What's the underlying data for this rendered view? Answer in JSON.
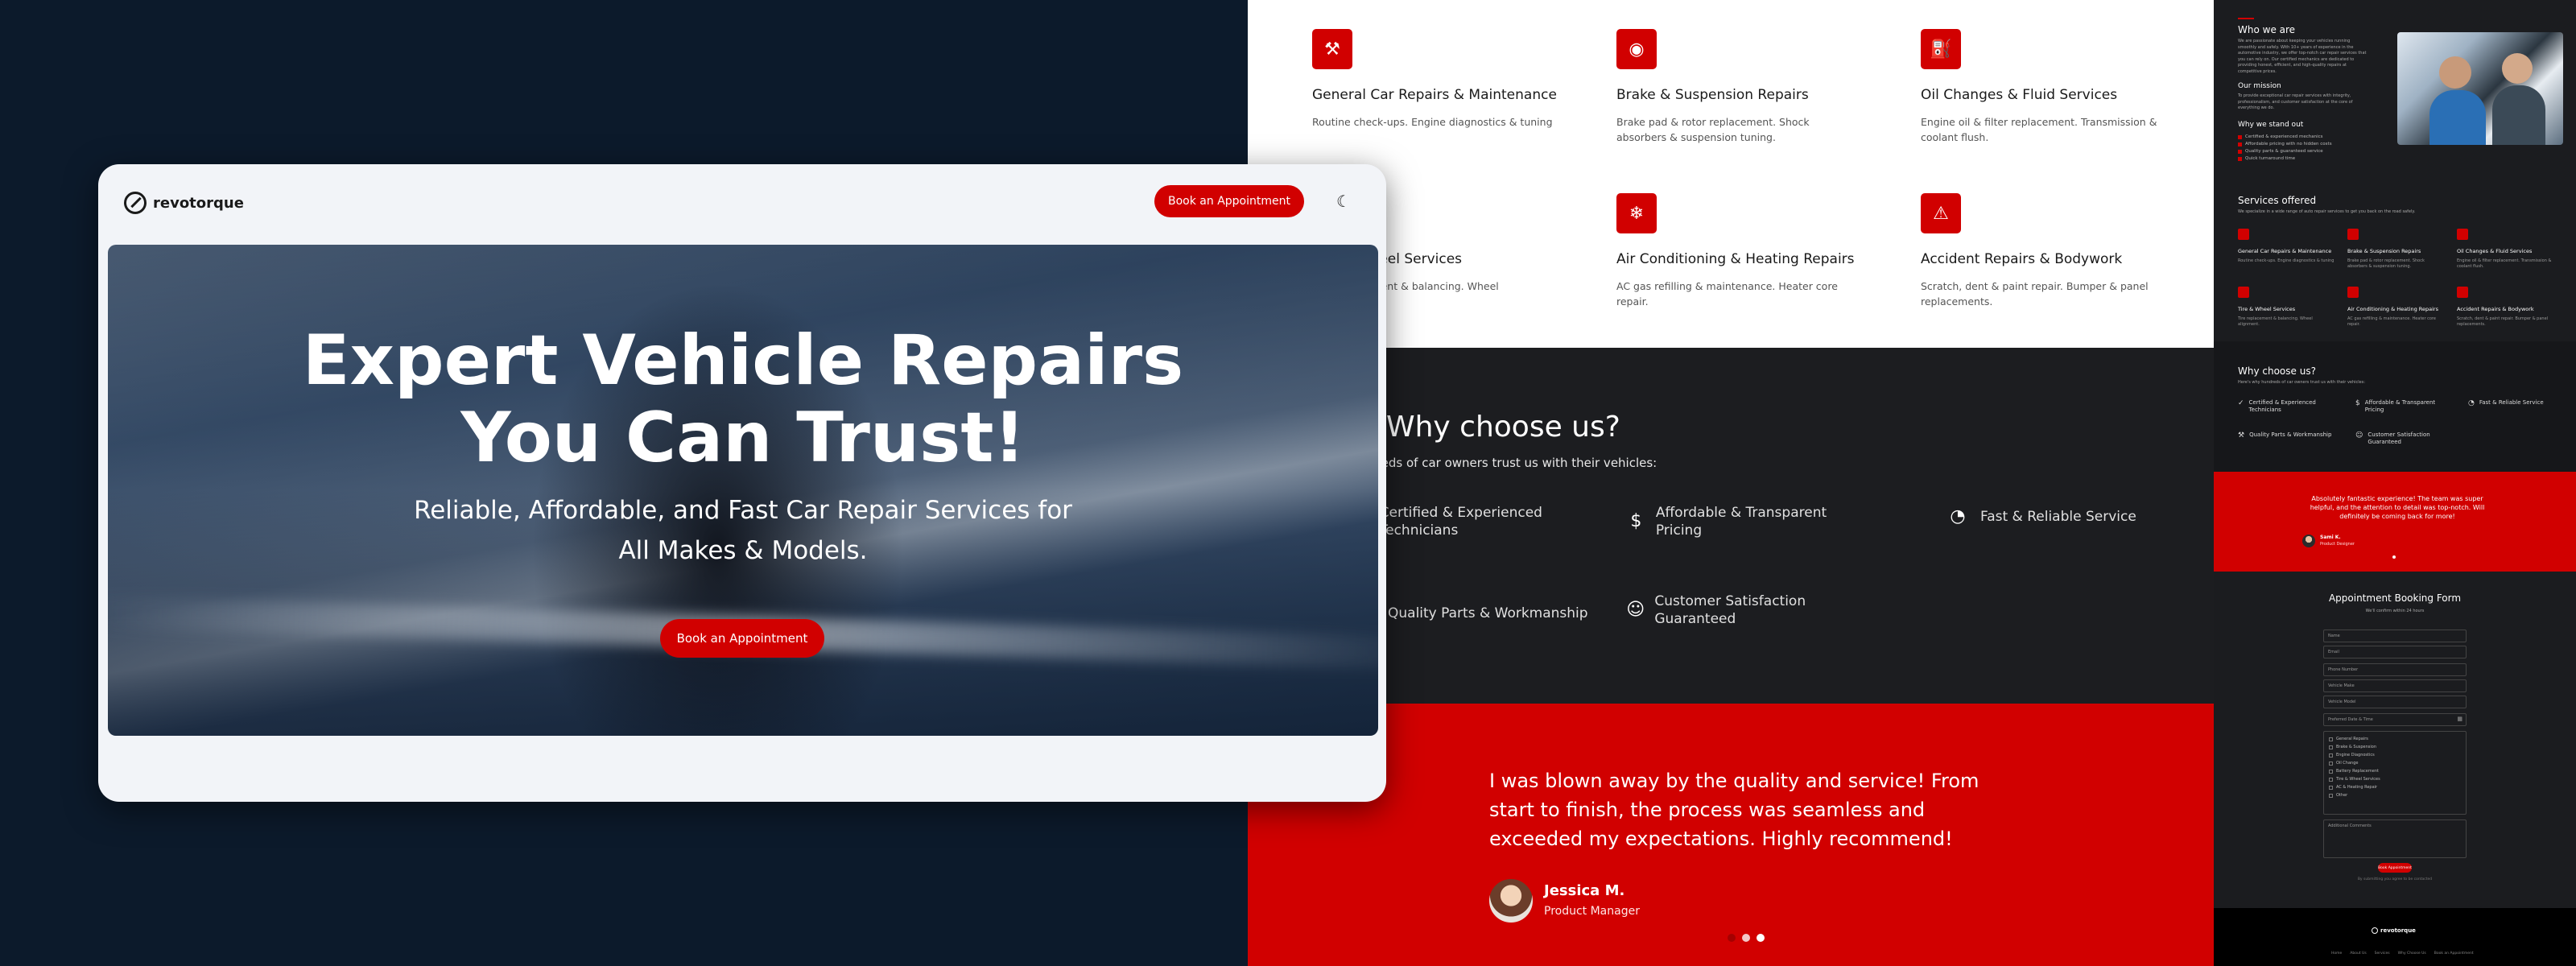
{
  "brand": "revotorque",
  "header": {
    "cta_label": "Book an Appointment",
    "theme_toggle_icon": "moon-icon"
  },
  "hero": {
    "title": "Expert Vehicle Repairs You Can Trust!",
    "subtitle": "Reliable, Affordable, and Fast Car Repair Services for All Makes & Models.",
    "cta_label": "Book an Appointment"
  },
  "services": [
    {
      "icon": "wrench-hammer-icon",
      "glyph": "⚒",
      "title": "General Car Repairs & Maintenance",
      "desc": "Routine check-ups. Engine diagnostics & tuning"
    },
    {
      "icon": "brake-icon",
      "glyph": "◉",
      "title": "Brake & Suspension Repairs",
      "desc": "Brake pad & rotor replacement. Shock absorbers & suspension tuning."
    },
    {
      "icon": "oil-can-icon",
      "glyph": "⛽",
      "title": "Oil Changes & Fluid Services",
      "desc": "Engine oil & filter replacement. Transmission & coolant flush."
    },
    {
      "icon": "tire-icon",
      "glyph": "◎",
      "title": "Tire & Wheel Services",
      "desc": "Tire replacement & balancing. Wheel alignment."
    },
    {
      "icon": "snowflake-icon",
      "glyph": "❄",
      "title": "Air Conditioning & Heating Repairs",
      "desc": "AC gas refilling & maintenance. Heater core repair."
    },
    {
      "icon": "car-crash-icon",
      "glyph": "⚠",
      "title": "Accident Repairs & Bodywork",
      "desc": "Scratch, dent & paint repair. Bumper & panel replacements."
    }
  ],
  "why": {
    "heading": "Why choose us?",
    "subheading": "Hundreds of car owners trust us with their vehicles:",
    "features": [
      {
        "icon": "certified-icon",
        "glyph": "✓",
        "label": "Certified & Experienced Technicians"
      },
      {
        "icon": "dollar-check-icon",
        "glyph": "$",
        "label": "Affordable & Transparent Pricing"
      },
      {
        "icon": "speedometer-icon",
        "glyph": "◔",
        "label": "Fast & Reliable Service"
      },
      {
        "icon": "tools-icon",
        "glyph": "⚒",
        "label": "Quality Parts & Workmanship"
      },
      {
        "icon": "smile-icon",
        "glyph": "☺",
        "label": "Customer Satisfaction Guaranteed"
      }
    ]
  },
  "testimonial": {
    "quote": "I was blown away by the quality and service! From start to finish, the process was seamless and exceeded my expectations. Highly recommend!",
    "name": "Jessica M.",
    "role": "Product Manager"
  },
  "right_panel": {
    "who_heading": "Who we are",
    "who_text": "We are passionate about keeping your vehicles running smoothly and safely. With 10+ years of experience in the automotive industry, we offer top-notch car repair services that you can rely on. Our certified mechanics are dedicated to providing honest, efficient, and high-quality repairs at competitive prices.",
    "mission_heading": "Our mission",
    "mission_text": "To provide exceptional car repair services with integrity, professionalism, and customer satisfaction at the core of everything we do.",
    "stand_heading": "Why we stand out",
    "stand_items": [
      "Certified & experienced mechanics",
      "Affordable pricing with no hidden costs",
      "Quality parts & guaranteed service",
      "Quick turnaround time"
    ],
    "services_heading": "Services offered",
    "services_sub": "We specialize in a wide range of auto repair services to get you back on the road safely.",
    "services": [
      {
        "title": "General Car Repairs & Maintenance",
        "desc": "Routine check-ups. Engine diagnostics & tuning"
      },
      {
        "title": "Brake & Suspension Repairs",
        "desc": "Brake pad & rotor replacement. Shock absorbers & suspension tuning."
      },
      {
        "title": "Oil Changes & Fluid Services",
        "desc": "Engine oil & filter replacement. Transmission & coolant flush."
      },
      {
        "title": "Tire & Wheel Services",
        "desc": "Tire replacement & balancing. Wheel alignment."
      },
      {
        "title": "Air Conditioning & Heating Repairs",
        "desc": "AC gas refilling & maintenance. Heater core repair."
      },
      {
        "title": "Accident Repairs & Bodywork",
        "desc": "Scratch, dent & paint repair. Bumper & panel replacements."
      }
    ],
    "why_heading": "Why choose us?",
    "why_sub": "Here's why hundreds of car owners trust us with their vehicles:",
    "why_items": [
      "Certified & Experienced Technicians",
      "Affordable & Transparent Pricing",
      "Fast & Reliable Service",
      "Quality Parts & Workmanship",
      "Customer Satisfaction Guaranteed"
    ],
    "testimonial_quote": "Absolutely fantastic experience! The team was super helpful, and the attention to detail was top-notch. Will definitely be coming back for more!",
    "testimonial_name": "Sami K.",
    "testimonial_role": "Product Designer",
    "form_heading": "Appointment Booking Form",
    "form_sub": "We'll confirm within 24 hours",
    "form_fields": [
      "Name",
      "Email",
      "Phone Number",
      "Vehicle Make",
      "Vehicle Model",
      "Preferred Date & Time"
    ],
    "form_options": [
      "General Repairs",
      "Brake & Suspension",
      "Engine Diagnostics",
      "Oil Change",
      "Battery Replacement",
      "Tire & Wheel Services",
      "AC & Heating Repair",
      "Other"
    ],
    "form_notes": "Additional Comments",
    "form_submit": "Book Appointment",
    "form_note": "By submitting you agree to be contacted",
    "footer_brand": "revotorque",
    "footer_links": [
      "Home",
      "About Us",
      "Services",
      "Why Choose Us",
      "Book an Appointment"
    ]
  },
  "colors": {
    "accent": "#d10000",
    "bg_dark": "#0c1a2b",
    "panel_dark": "#1c1d20"
  }
}
